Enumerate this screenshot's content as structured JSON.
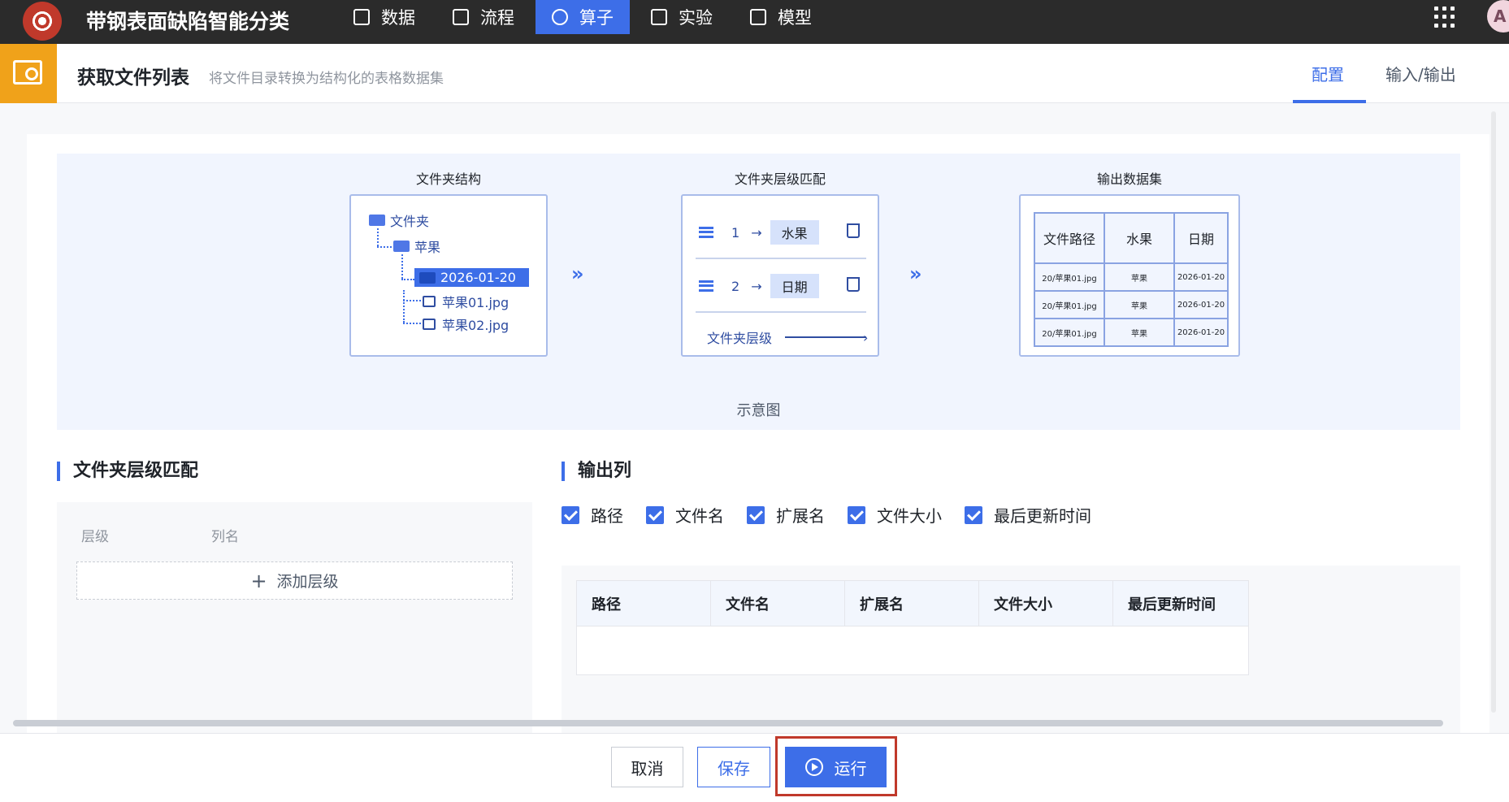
{
  "topbar": {
    "app_title": "带钢表面缺陷智能分类",
    "nav": [
      {
        "label": "数据",
        "icon": "table-icon"
      },
      {
        "label": "流程",
        "icon": "flow-icon"
      },
      {
        "label": "算子",
        "icon": "gear-icon",
        "active": true
      },
      {
        "label": "实验",
        "icon": "cube-icon"
      },
      {
        "label": "模型",
        "icon": "save-icon"
      }
    ],
    "avatar_initial": "A"
  },
  "header": {
    "title": "获取文件列表",
    "description": "将文件目录转换为结构化的表格数据集",
    "tabs": [
      {
        "label": "配置",
        "active": true
      },
      {
        "label": "输入/输出"
      }
    ]
  },
  "diagram": {
    "folder_structure": {
      "title": "文件夹结构",
      "root": "文件夹",
      "level1": "苹果",
      "level2": "2026-01-20",
      "files": [
        "苹果01.jpg",
        "苹果02.jpg"
      ]
    },
    "level_match": {
      "title": "文件夹层级匹配",
      "rows": [
        {
          "index": "1",
          "name": "水果"
        },
        {
          "index": "2",
          "name": "日期"
        }
      ],
      "footer": "文件夹层级"
    },
    "output_dataset": {
      "title": "输出数据集",
      "headers": [
        "文件路径",
        "水果",
        "日期"
      ],
      "rows": [
        [
          "20/苹果01.jpg",
          "苹果",
          "2026-01-20"
        ],
        [
          "20/苹果01.jpg",
          "苹果",
          "2026-01-20"
        ],
        [
          "20/苹果01.jpg",
          "苹果",
          "2026-01-20"
        ]
      ]
    },
    "caption": "示意图"
  },
  "level_section": {
    "title": "文件夹层级匹配",
    "col_level": "层级",
    "col_name": "列名",
    "add_label": "添加层级"
  },
  "output_section": {
    "title": "输出列",
    "checkboxes": [
      "路径",
      "文件名",
      "扩展名",
      "文件大小",
      "最后更新时间"
    ],
    "table_headers": [
      "路径",
      "文件名",
      "扩展名",
      "文件大小",
      "最后更新时间"
    ]
  },
  "footer": {
    "cancel": "取消",
    "save": "保存",
    "run": "运行"
  },
  "colors": {
    "accent": "#3d6ee8",
    "header_icon_bg": "#f0a21a",
    "topbar": "#2b2b2b",
    "highlight": "#c0392b"
  }
}
